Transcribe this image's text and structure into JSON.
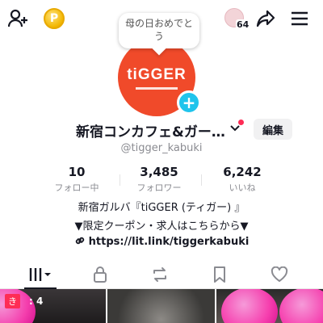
{
  "header": {
    "coin_symbol": "P",
    "visitor_count": "64"
  },
  "bubble": {
    "text": "母の日おめでとう"
  },
  "profile": {
    "avatar_logo": "tiGGER",
    "display_name": "新宿コンカフェ&ガー…",
    "edit_label": "編集",
    "handle": "@tigger_kabuki"
  },
  "stats": [
    {
      "value": "10",
      "label": "フォロー中"
    },
    {
      "value": "3,485",
      "label": "フォロワー"
    },
    {
      "value": "6,242",
      "label": "いいね"
    }
  ],
  "bio": {
    "line1": "新宿ガルバ『tiGGER (ティガー) 』",
    "line2": "▼限定クーポン・求人はこちらから▼",
    "link": "https://lit.link/tiggerkabuki"
  },
  "tabs": [
    {
      "name": "videos",
      "icon": "grid-bars-icon",
      "active": true
    },
    {
      "name": "private",
      "icon": "lock-icon"
    },
    {
      "name": "reposts",
      "icon": "repost-icon"
    },
    {
      "name": "favorites",
      "icon": "bookmark-icon"
    },
    {
      "name": "liked",
      "icon": "heart-icon"
    }
  ],
  "videos": [
    {
      "badge_text": "き",
      "views": ": 4"
    }
  ],
  "colors": {
    "accent_blue": "#20c4ec",
    "avatar_bg": "#f04a2a",
    "notify_red": "#fe2c55"
  }
}
